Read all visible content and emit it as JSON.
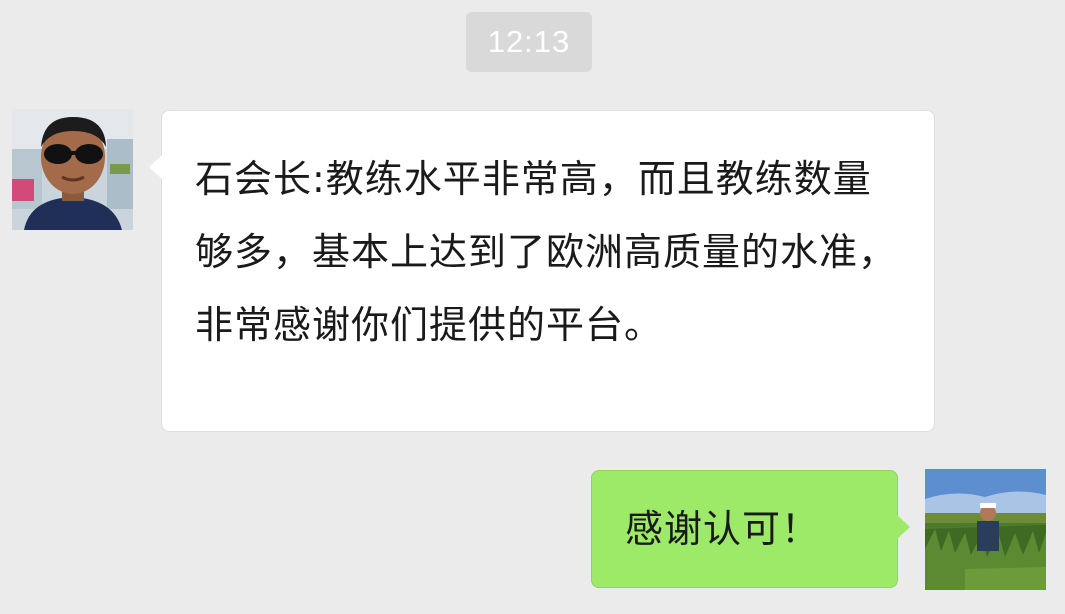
{
  "timestamp": "12:13",
  "messages": [
    {
      "side": "incoming",
      "avatar": "boy-with-sunglasses-avatar",
      "text": "石会长:教练水平非常高，而且教练数量够多，基本上达到了欧洲高质量的水准，非常感谢你们提供的平台。"
    },
    {
      "side": "outgoing",
      "avatar": "man-in-grass-field-avatar",
      "text": "感谢认可！"
    }
  ],
  "colors": {
    "background": "#ebebeb",
    "timestamp_bg": "#d9d9d9",
    "incoming_bubble": "#ffffff",
    "outgoing_bubble": "#9de968"
  }
}
